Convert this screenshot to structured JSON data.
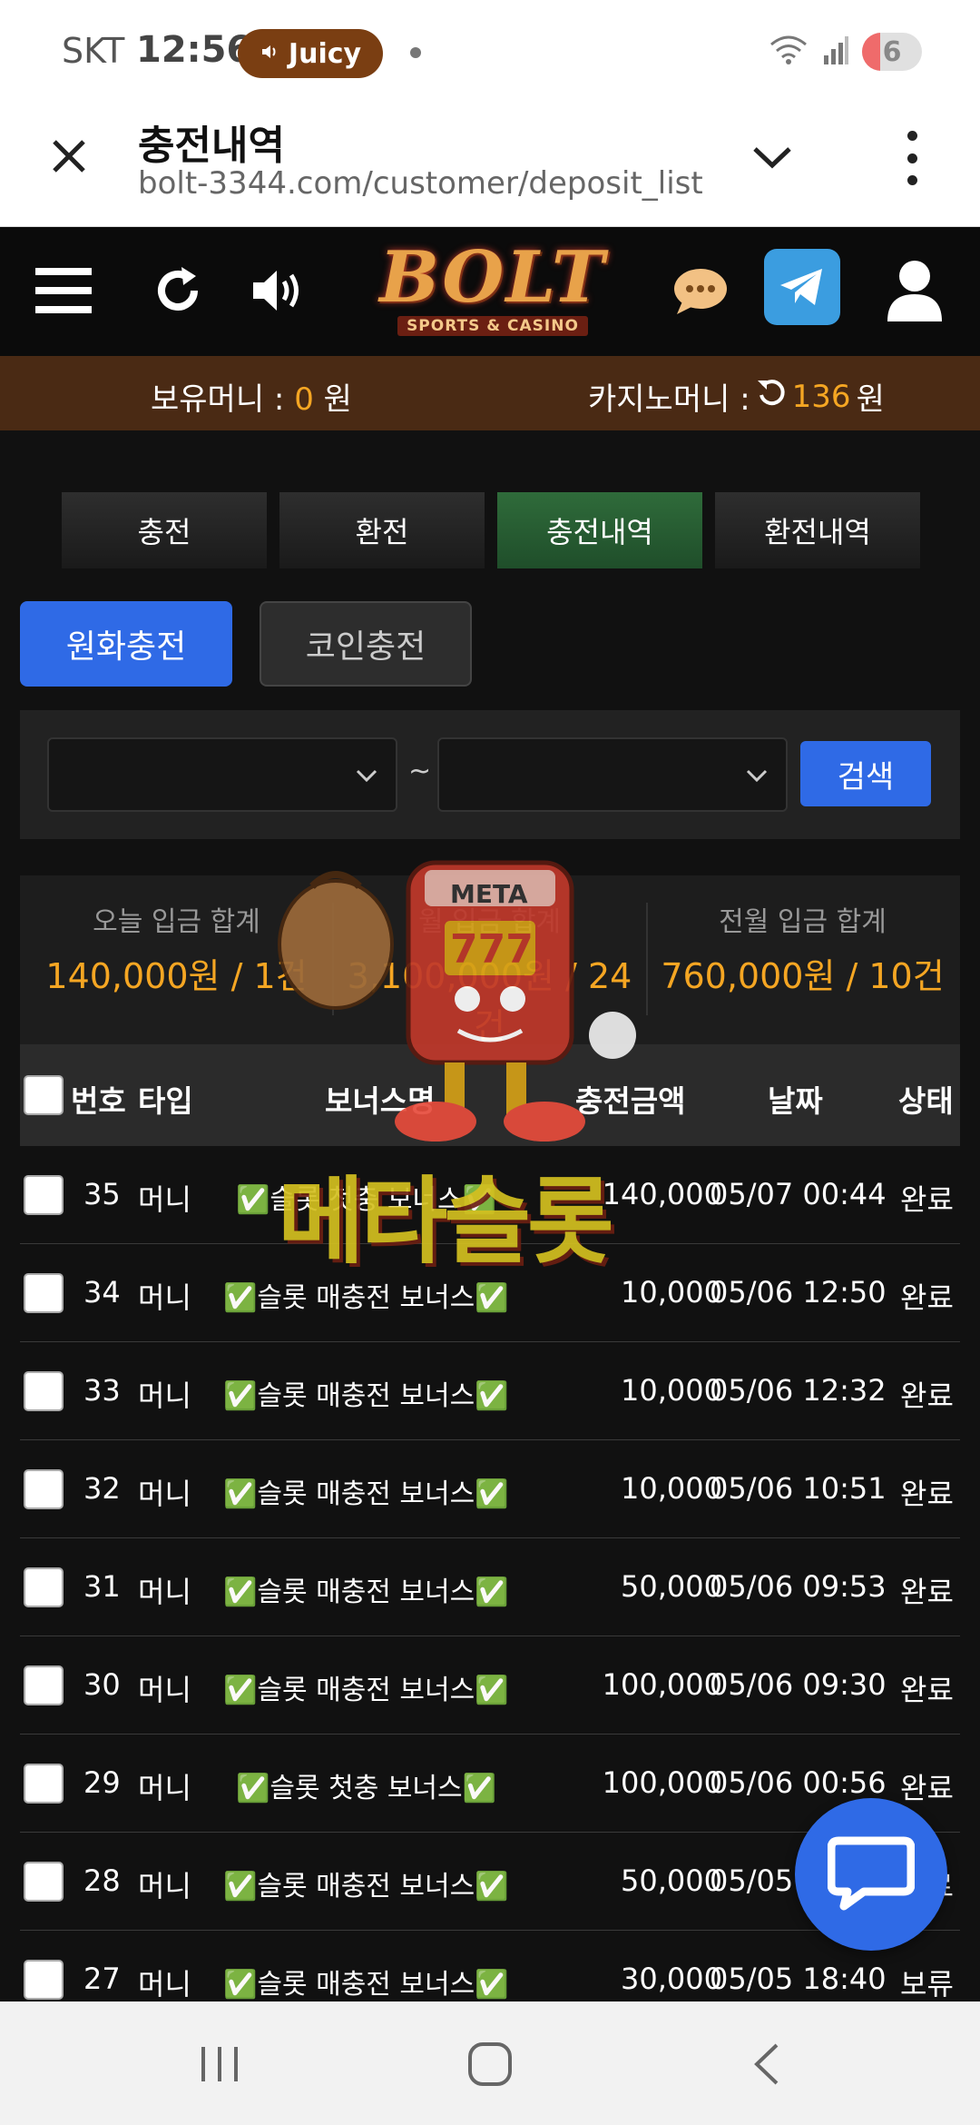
{
  "status_bar": {
    "carrier": "SKT",
    "time": "12:56",
    "pill_label": "Juicy",
    "battery": "6",
    "icons": [
      "wifi-icon",
      "signal-icon",
      "volume-icon"
    ]
  },
  "browser": {
    "page_title": "충전내역",
    "url": "bolt-3344.com/customer/deposit_list"
  },
  "header": {
    "logo_word": "BOLT",
    "logo_sub": "SPORTS & CASINO",
    "icons": [
      "menu-icon",
      "refresh-icon",
      "sound-icon",
      "chat-bubble-icon",
      "telegram-icon",
      "user-icon"
    ]
  },
  "balance": {
    "held_label": "보유머니 :",
    "held_value": "0",
    "casino_label": "카지노머니 :",
    "casino_value": "136",
    "unit": "원"
  },
  "tabs": [
    {
      "label": "충전",
      "active": false
    },
    {
      "label": "환전",
      "active": false
    },
    {
      "label": "충전내역",
      "active": true
    },
    {
      "label": "환전내역",
      "active": false
    }
  ],
  "sub_tabs": {
    "won": "원화충전",
    "coin": "코인충전"
  },
  "filter": {
    "from_value": "",
    "to_value": "",
    "separator": "~",
    "search_label": "검색"
  },
  "summary": {
    "today_label": "오늘 입금 합계",
    "today_value": "140,000원 / 1건",
    "month_label": "월 입금 합계",
    "month_value": "3,100,000원 / 24건",
    "prev_label": "전월 입금 합계",
    "prev_value": "760,000원 / 10건"
  },
  "table": {
    "headers": {
      "no": "번호",
      "type": "타입",
      "bonus": "보너스명",
      "amount": "충전금액",
      "date": "날짜",
      "status": "상태"
    },
    "rows": [
      {
        "no": "35",
        "type": "머니",
        "bonus": "✅슬롯 첫충 보너스✅",
        "amount": "140,000",
        "date": "05/07 00:44",
        "status": "완료"
      },
      {
        "no": "34",
        "type": "머니",
        "bonus": "✅슬롯 매충전 보너스✅",
        "amount": "10,000",
        "date": "05/06 12:50",
        "status": "완료"
      },
      {
        "no": "33",
        "type": "머니",
        "bonus": "✅슬롯 매충전 보너스✅",
        "amount": "10,000",
        "date": "05/06 12:32",
        "status": "완료"
      },
      {
        "no": "32",
        "type": "머니",
        "bonus": "✅슬롯 매충전 보너스✅",
        "amount": "10,000",
        "date": "05/06 10:51",
        "status": "완료"
      },
      {
        "no": "31",
        "type": "머니",
        "bonus": "✅슬롯 매충전 보너스✅",
        "amount": "50,000",
        "date": "05/06 09:53",
        "status": "완료"
      },
      {
        "no": "30",
        "type": "머니",
        "bonus": "✅슬롯 매충전 보너스✅",
        "amount": "100,000",
        "date": "05/06 09:30",
        "status": "완료"
      },
      {
        "no": "29",
        "type": "머니",
        "bonus": "✅슬롯 첫충 보너스✅",
        "amount": "100,000",
        "date": "05/06 00:56",
        "status": "완료"
      },
      {
        "no": "28",
        "type": "머니",
        "bonus": "✅슬롯 매충전 보너스✅",
        "amount": "50,000",
        "date": "05/05",
        "status": "완료"
      },
      {
        "no": "27",
        "type": "머니",
        "bonus": "✅슬롯 매충전 보너스✅",
        "amount": "30,000",
        "date": "05/05 18:40",
        "status": "보류"
      }
    ]
  },
  "watermark": {
    "badge": "META",
    "reels": "777",
    "caption": "메타슬롯"
  },
  "colors": {
    "accent_orange": "#f5a623",
    "primary_blue": "#2f6ae6",
    "active_tab_green": "#2f6b3a",
    "balance_bar_brown": "#4a2a14"
  },
  "nav": [
    "recent-apps-icon",
    "home-icon",
    "back-icon"
  ]
}
